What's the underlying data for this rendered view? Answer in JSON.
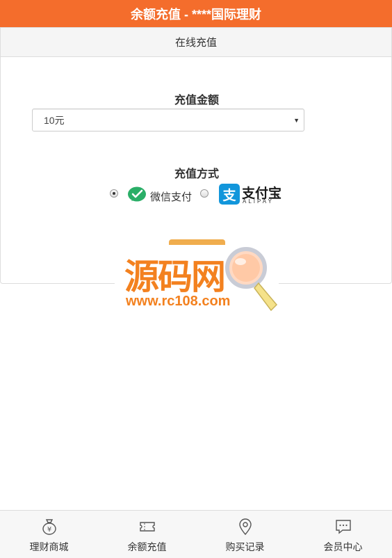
{
  "header": {
    "title": "余额充值 - ****国际理财"
  },
  "panel": {
    "heading": "在线充值"
  },
  "amount": {
    "label": "充值金额",
    "selected": "10元"
  },
  "method": {
    "label": "充值方式",
    "options": [
      {
        "label": "微信支付",
        "checked": true,
        "icon": "wechat-pay-icon"
      },
      {
        "label": "支付宝",
        "sublabel": "ALIPAY",
        "checked": false,
        "icon": "alipay-icon",
        "glyph": "支"
      }
    ]
  },
  "watermark": {
    "title": "源码网",
    "url": "www.rc108.com"
  },
  "bottom_nav": {
    "items": [
      {
        "label": "理财商城",
        "icon": "money-bag-icon"
      },
      {
        "label": "余额充值",
        "icon": "ticket-icon"
      },
      {
        "label": "购买记录",
        "icon": "location-pin-icon"
      },
      {
        "label": "会员中心",
        "icon": "chat-bubble-icon"
      }
    ]
  },
  "colors": {
    "header_bg": "#f46d2c",
    "button_bg": "#f0ad4e",
    "alipay_blue": "#1296db",
    "wechat_green": "#2aae67",
    "watermark_orange": "#f3811f"
  }
}
